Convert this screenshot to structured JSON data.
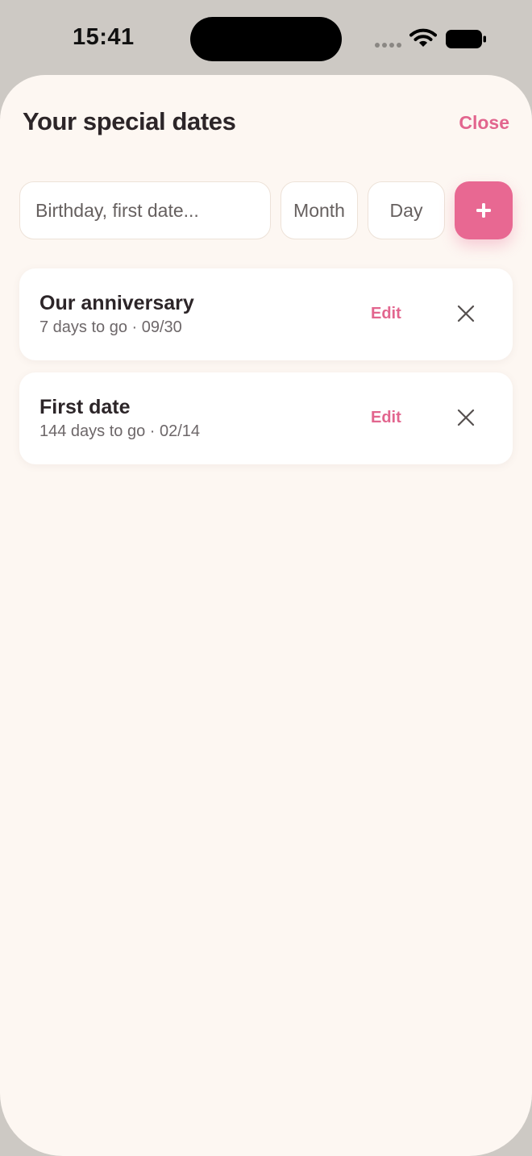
{
  "status_bar": {
    "time": "15:41",
    "icons": [
      "cellular-signal-icon",
      "wifi-icon",
      "battery-icon"
    ]
  },
  "sheet": {
    "title": "Your special dates",
    "close_label": "Close"
  },
  "form": {
    "name_placeholder": "Birthday, first date...",
    "month_placeholder": "Month",
    "day_placeholder": "Day",
    "add_icon": "plus-icon"
  },
  "dates": [
    {
      "title": "Our anniversary",
      "subtitle": "7 days to go · 09/30",
      "edit_label": "Edit"
    },
    {
      "title": "First date",
      "subtitle": "144 days to go · 02/14",
      "edit_label": "Edit"
    }
  ],
  "colors": {
    "accent": "#e2658e",
    "add_button": "#e86892",
    "sheet_background": "#fdf7f2",
    "backdrop": "#cdc9c4",
    "text_primary": "#2c2528",
    "text_secondary": "#6d6769"
  }
}
